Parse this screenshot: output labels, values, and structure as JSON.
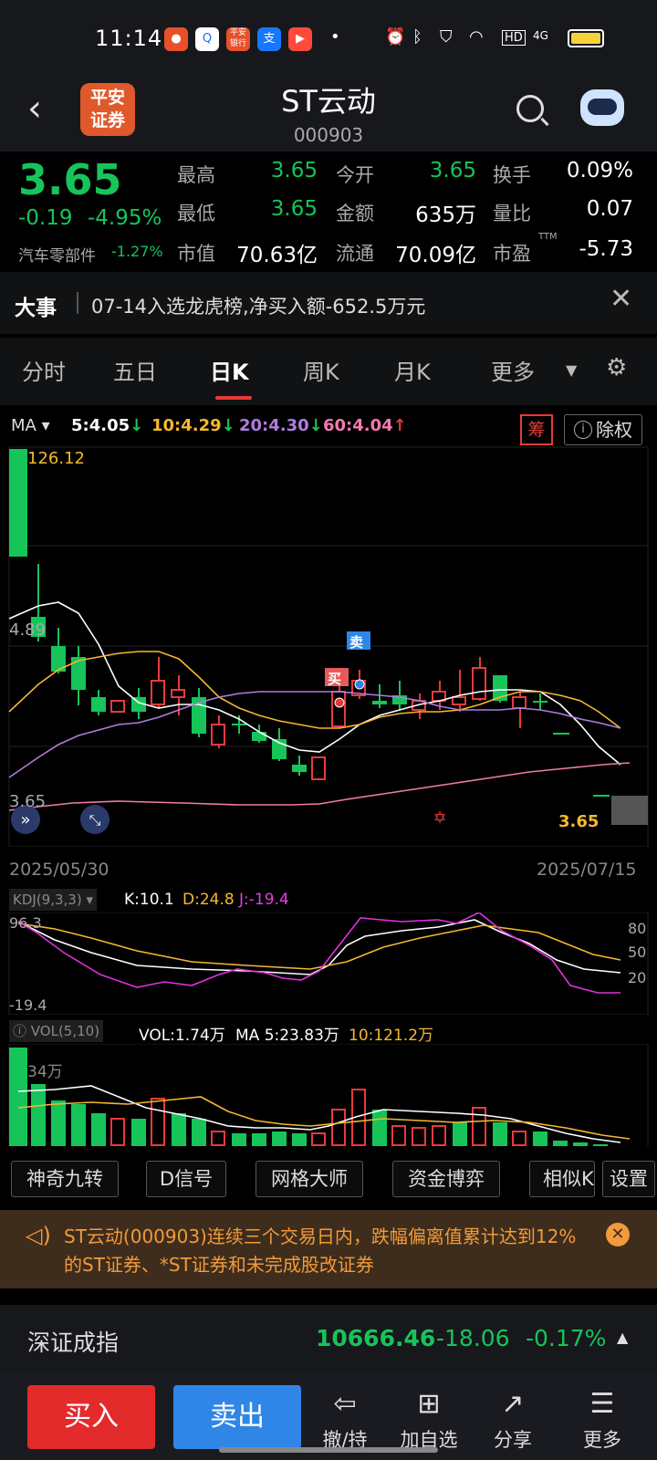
{
  "status_bar": {
    "time": "11:14",
    "app_icons": [
      "平安",
      "搜",
      "平安银行",
      "支",
      "视频"
    ],
    "indicator_icons": [
      "alarm-icon",
      "bluetooth-icon",
      "shield-icon",
      "wifi-icon",
      "hd-icon",
      "signal-4g-icon",
      "battery-icon"
    ],
    "hd_label": "HD",
    "net_label": "4G"
  },
  "header": {
    "logo_text_1": "平安",
    "logo_text_2": "证券",
    "title": "ST云动",
    "code": "000903"
  },
  "quote": {
    "price": "3.65",
    "change": "-0.19",
    "change_pct": "-4.95%",
    "sector_name": "汽车零部件",
    "sector_pct": "-1.27%",
    "fields": [
      {
        "label": "最高",
        "value": "3.65",
        "color": "green"
      },
      {
        "label": "今开",
        "value": "3.65",
        "color": "green"
      },
      {
        "label": "换手",
        "value": "0.09%",
        "color": "white"
      },
      {
        "label": "最低",
        "value": "3.65",
        "color": "green"
      },
      {
        "label": "金额",
        "value": "635万",
        "color": "white"
      },
      {
        "label": "量比",
        "value": "0.07",
        "color": "white"
      },
      {
        "label": "市值",
        "value": "70.63亿",
        "color": "white"
      },
      {
        "label": "流通",
        "value": "70.09亿",
        "color": "white"
      },
      {
        "label": "市盈",
        "value": "-5.73",
        "color": "white"
      }
    ],
    "pe_sup": "TTM"
  },
  "news": {
    "title": "大事",
    "text": "07-14入选龙虎榜,净买入额-652.5万元"
  },
  "tabs": {
    "items": [
      "分时",
      "五日",
      "日K",
      "周K",
      "月K",
      "更多"
    ],
    "active": "日K"
  },
  "ma_legend": {
    "label": "MA",
    "ma5": "5:4.05",
    "ma10": "10:4.29",
    "ma20": "20:4.30",
    "ma60": "60:4.04",
    "chou": "筹",
    "chuquan": "除权",
    "colors": {
      "ma5": "#ffffff",
      "ma10": "#f5b82e",
      "ma20": "#b07be0",
      "ma60": "#f27ab1"
    }
  },
  "kline": {
    "high_label": "126.12",
    "mid_label": "4.89",
    "low_label": "3.65",
    "last_price_label": "3.65",
    "start_date": "2025/05/30",
    "end_date": "2025/07/15",
    "buy_marker": "买",
    "sell_marker": "卖"
  },
  "kdj": {
    "label": "KDJ(9,3,3)",
    "k": "K:10.1",
    "d": "D:24.8",
    "j": "J:-19.4",
    "top_label": "96.3",
    "bottom_label": "-19.4",
    "levels": [
      "80",
      "50",
      "20"
    ]
  },
  "vol": {
    "label": "VOL(5,10)",
    "vol": "VOL:1.74万",
    "ma5": "MA 5:23.83万",
    "ma10": "10:121.2万",
    "axis_label": "34万"
  },
  "chart_data": {
    "type": "candlestick",
    "x_range": [
      "2025/05/30",
      "2025/07/15"
    ],
    "y_range": [
      3.65,
      4.89
    ],
    "indicators": {
      "MA5": 4.05,
      "MA10": 4.29,
      "MA20": 4.3,
      "MA60": 4.04,
      "K": 10.1,
      "D": 24.8,
      "J": -19.4,
      "VOL": "1.74万"
    }
  },
  "tools": [
    "神奇九转",
    "D信号",
    "网格大师",
    "资金博弈",
    "相似K",
    "设置"
  ],
  "notice": {
    "text": "ST云动(000903)连续三个交易日内，跌幅偏离值累计达到12%的ST证券、*ST证券和未完成股改证券"
  },
  "index": {
    "name": "深证成指",
    "value": "10666.46",
    "change": "-18.06",
    "pct": "-0.17%"
  },
  "bottom": {
    "buy": "买入",
    "sell": "卖出",
    "items": [
      {
        "label": "撤/持",
        "icon": "cancel-hold-icon"
      },
      {
        "label": "加自选",
        "icon": "add-watchlist-icon"
      },
      {
        "label": "分享",
        "icon": "share-icon"
      },
      {
        "label": "更多",
        "icon": "more-icon"
      }
    ]
  }
}
